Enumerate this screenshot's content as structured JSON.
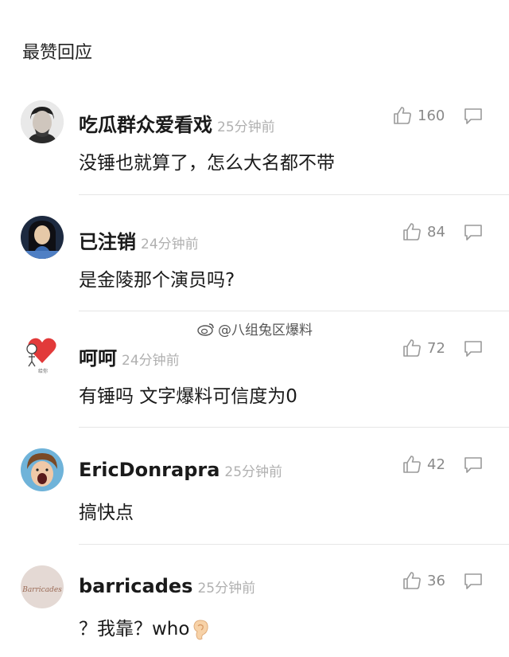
{
  "header": {
    "title": "最赞回应"
  },
  "watermark": {
    "text": "@八组兔区爆料"
  },
  "comments": [
    {
      "name": "吃瓜群众爱看戏",
      "time": "25分钟前",
      "text": "没锤也就算了，怎么大名都不带",
      "likes": "160"
    },
    {
      "name": "已注销",
      "time": "24分钟前",
      "text": "是金陵那个演员吗?",
      "likes": "84"
    },
    {
      "name": "呵呵",
      "time": "24分钟前",
      "text": "有锤吗 文字爆料可信度为0",
      "likes": "72",
      "avatar_caption": "给你"
    },
    {
      "name": "EricDonrapra",
      "time": "25分钟前",
      "text": "搞快点",
      "likes": "42"
    },
    {
      "name": "barricades",
      "time": "25分钟前",
      "text": "？我靠？who",
      "likes": "36",
      "avatar_text": "Barricades",
      "text_emoji": "ear-emoji"
    }
  ],
  "icons": {
    "like": "thumbs-up-icon",
    "reply": "comment-bubble-icon"
  },
  "colors": {
    "time": "#b0b0b0",
    "count": "#8a8a8a",
    "divider": "#e6e6e6"
  }
}
